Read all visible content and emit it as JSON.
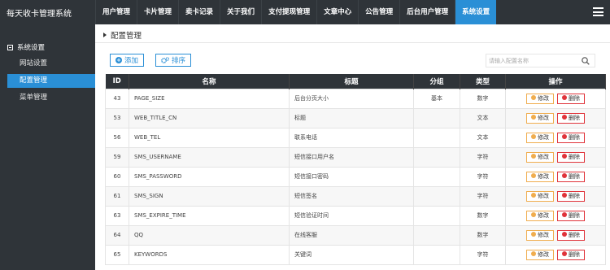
{
  "app": {
    "title": "每天收卡管理系统"
  },
  "nav": [
    "用户管理",
    "卡片管理",
    "卖卡记录",
    "关于我们",
    "支付提现管理",
    "文章中心",
    "公告管理",
    "后台用户管理",
    "系统设置"
  ],
  "nav_active_index": 8,
  "sidebar": {
    "section": "系统设置",
    "items": [
      "网站设置",
      "配置管理",
      "菜单管理"
    ],
    "active_index": 1
  },
  "breadcrumb": "配置管理",
  "toolbar": {
    "add_label": "添加",
    "sort_label": "排序"
  },
  "search": {
    "placeholder": "请输入配置名称"
  },
  "table": {
    "headers": [
      "ID",
      "名称",
      "标题",
      "分组",
      "类型",
      "操作"
    ],
    "edit_label": "修改",
    "delete_label": "删除",
    "rows": [
      {
        "id": "43",
        "name": "PAGE_SIZE",
        "title": "后台分页大小",
        "group": "基本",
        "type": "数字"
      },
      {
        "id": "53",
        "name": "WEB_TITLE_CN",
        "title": "标题",
        "group": "",
        "type": "文本"
      },
      {
        "id": "56",
        "name": "WEB_TEL",
        "title": "联系电话",
        "group": "",
        "type": "文本"
      },
      {
        "id": "59",
        "name": "SMS_USERNAME",
        "title": "短信接口用户名",
        "group": "",
        "type": "字符"
      },
      {
        "id": "60",
        "name": "SMS_PASSWORD",
        "title": "短信接口密码",
        "group": "",
        "type": "字符"
      },
      {
        "id": "61",
        "name": "SMS_SIGN",
        "title": "短信签名",
        "group": "",
        "type": "字符"
      },
      {
        "id": "63",
        "name": "SMS_EXPIRE_TIME",
        "title": "短信验证时间",
        "group": "",
        "type": "数字"
      },
      {
        "id": "64",
        "name": "QQ",
        "title": "在线客服",
        "group": "",
        "type": "数字"
      },
      {
        "id": "65",
        "name": "KEYWORDS",
        "title": "关键词",
        "group": "",
        "type": "字符"
      }
    ]
  },
  "colors": {
    "dark": "#2f3439",
    "accent": "#2a8fd6",
    "edit": "#f0ad4e",
    "delete": "#e0333a"
  }
}
